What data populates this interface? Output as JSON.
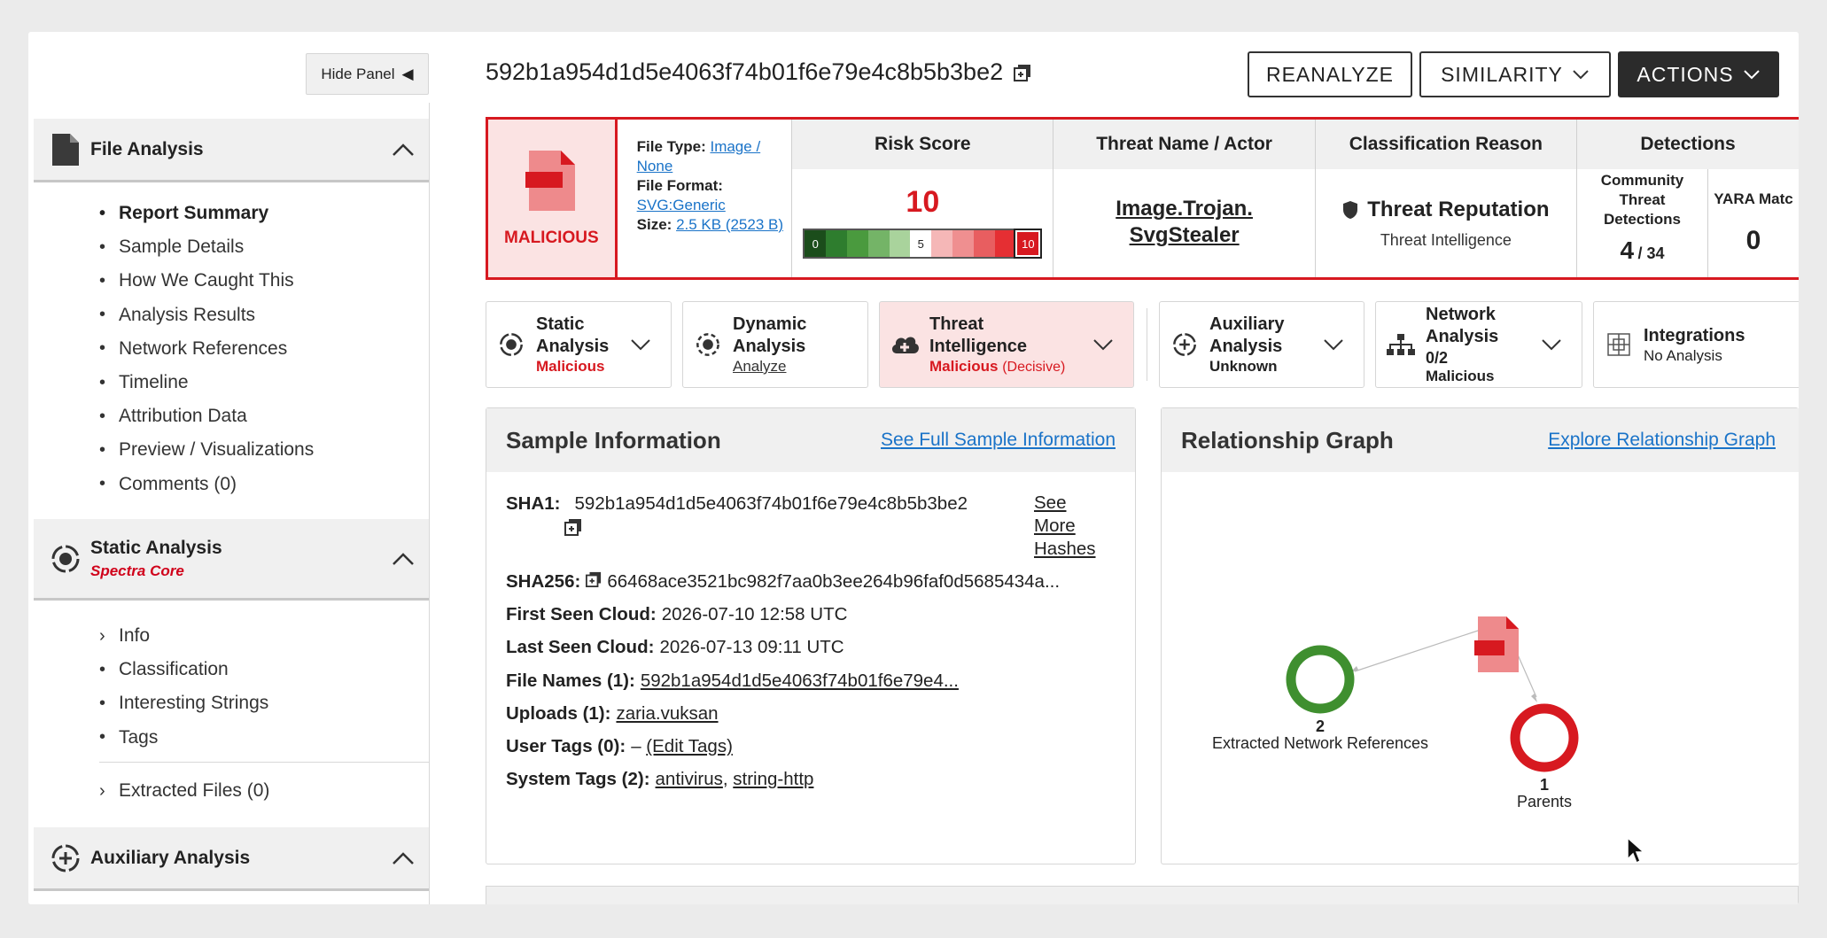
{
  "hide_panel": "Hide Panel",
  "sidebar": {
    "file_analysis": {
      "title": "File Analysis",
      "items": [
        "Report Summary",
        "Sample Details",
        "How We Caught This",
        "Analysis Results",
        "Network References",
        "Timeline",
        "Attribution Data",
        "Preview / Visualizations",
        "Comments (0)"
      ]
    },
    "static_analysis": {
      "title": "Static Analysis",
      "subtitle": "Spectra Core",
      "items": [
        "Info",
        "Classification",
        "Interesting Strings",
        "Tags"
      ],
      "extracted": "Extracted Files (0)"
    },
    "auxiliary_analysis": {
      "title": "Auxiliary Analysis"
    }
  },
  "header": {
    "hash": "592b1a954d1d5e4063f74b01f6e79e4c8b5b3be2",
    "reanalyze": "REANALYZE",
    "similarity": "SIMILARITY",
    "actions": "ACTIONS"
  },
  "summary": {
    "verdict": "MALICIOUS",
    "file_type_label": "File Type:",
    "file_type_value": "Image / None",
    "file_format_label": "File Format:",
    "file_format_value": "SVG:Generic",
    "size_label": "Size:",
    "size_value": "2.5 KB (2523 B)",
    "risk_score_head": "Risk Score",
    "risk_score": "10",
    "risk_scale_low": "0",
    "risk_scale_mid": "5",
    "risk_scale_high": "10",
    "threat_head": "Threat Name / Actor",
    "threat_line1": "Image.Trojan.",
    "threat_line2": "SvgStealer",
    "class_head": "Classification Reason",
    "class_main": "Threat Reputation",
    "class_sub": "Threat Intelligence",
    "detections_head": "Detections",
    "community_label": "Community Threat Detections",
    "community_value": "4",
    "community_total": "/ 34",
    "yara_label": "YARA Matc",
    "yara_value": "0"
  },
  "tabs": [
    {
      "title": "Static Analysis",
      "status": "Malicious"
    },
    {
      "title": "Dynamic Analysis",
      "status": "Analyze"
    },
    {
      "title": "Threat Intelligence",
      "status": "Malicious",
      "status_extra": "(Decisive)"
    },
    {
      "title": "Auxiliary Analysis",
      "status": "Unknown"
    },
    {
      "title": "Network Analysis",
      "title_extra": "0/2",
      "status": "Malicious"
    },
    {
      "title": "Integrations",
      "status": "No Analysis"
    }
  ],
  "sample_info": {
    "title": "Sample Information",
    "link": "See Full Sample Information",
    "sha1_label": "SHA1:",
    "sha1": "592b1a954d1d5e4063f74b01f6e79e4c8b5b3be2",
    "see_more": "See More Hashes",
    "sha256_label": "SHA256:",
    "sha256": "66468ace3521bc982f7aa0b3ee264b96faf0d5685434a...",
    "first_seen_label": "First Seen Cloud:",
    "first_seen": "2026-07-10 12:58 UTC",
    "last_seen_label": "Last Seen Cloud:",
    "last_seen": "2026-07-13 09:11 UTC",
    "file_names_label": "File Names (1):",
    "file_names": "592b1a954d1d5e4063f74b01f6e79e4...",
    "uploads_label": "Uploads (1):",
    "uploads": "zaria.vuksan",
    "user_tags_label": "User Tags (0):",
    "user_tags_dash": "–",
    "edit_tags": "(Edit Tags)",
    "system_tags_label": "System Tags (2):",
    "system_tag_1": "antivirus",
    "system_tag_2": "string-http"
  },
  "graph": {
    "title": "Relationship Graph",
    "link": "Explore Relationship Graph",
    "node_green_count": "2",
    "node_green_label": "Extracted Network References",
    "node_red_count": "1",
    "node_red_label": "Parents"
  },
  "colors": {
    "malicious": "#d71920",
    "link": "#1a73c8",
    "green": "#3f8f2f"
  }
}
